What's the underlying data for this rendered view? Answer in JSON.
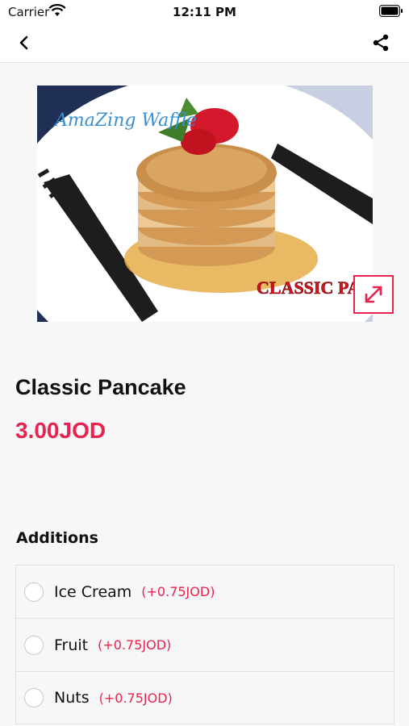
{
  "status_bar": {
    "carrier": "Carrier",
    "time": "12:11 PM"
  },
  "nav": {
    "back_icon": "chevron-left-icon",
    "share_icon": "share-icon"
  },
  "product": {
    "image_brand_text": "AmaZing Waffle",
    "image_caption_text": "CLASSIC PANCAKE",
    "title": "Classic Pancake",
    "price": "3.00JOD"
  },
  "additions": {
    "title": "Additions",
    "items": [
      {
        "name": "Ice Cream",
        "price": "(+0.75JOD)"
      },
      {
        "name": "Fruit",
        "price": "(+0.75JOD)"
      },
      {
        "name": "Nuts",
        "price": "(+0.75JOD)"
      }
    ]
  },
  "colors": {
    "accent": "#e8234f",
    "background": "#f7f7f7"
  }
}
